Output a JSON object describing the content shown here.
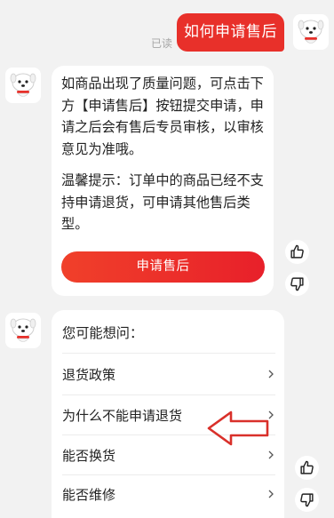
{
  "user_message": {
    "text": "如何申请售后",
    "read_status": "已读"
  },
  "bot_reply": {
    "paragraph1": "如商品出现了质量问题，可点击下方【申请售后】按钮提交申请，申请之后会有售后专员审核，以审核意见为准哦。",
    "paragraph2": "温馨提示：订单中的商品已经不支持申请退货，可申请其他售后类型。",
    "button_label": "申请售后"
  },
  "suggestions": {
    "title": "您可能想问：",
    "items": [
      {
        "label": "退货政策"
      },
      {
        "label": "为什么不能申请退货"
      },
      {
        "label": "能否换货"
      },
      {
        "label": "能否维修"
      }
    ]
  },
  "icons": {
    "bot_avatar": "jd-joy-dog-icon",
    "user_avatar": "jd-joy-dog-icon",
    "like": "thumbs-up-icon",
    "dislike": "thumbs-down-icon",
    "chevron": "chevron-right-icon",
    "annotation": "red-outline-arrow-left"
  },
  "colors": {
    "accent_red": "#e8302a",
    "background": "#f2f2f2",
    "card": "#ffffff",
    "annotation_arrow": "#d9302a"
  }
}
